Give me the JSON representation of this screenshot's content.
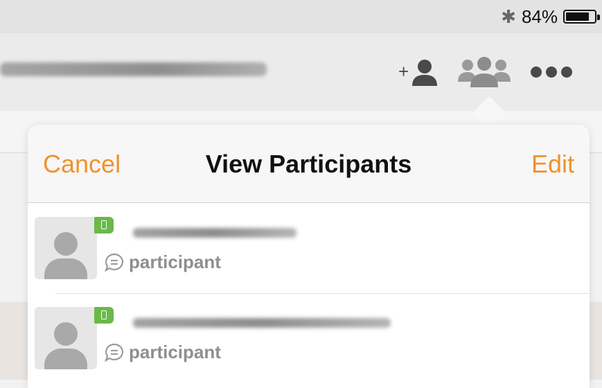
{
  "status_bar": {
    "bluetooth_icon": "bluetooth-icon",
    "battery_percent": "84%",
    "battery_level": 0.84
  },
  "toolbar": {
    "add_participant_icon": "add-person-icon",
    "participants_icon": "group-icon",
    "more_icon": "more-dots-icon"
  },
  "popover": {
    "cancel_label": "Cancel",
    "title": "View Participants",
    "edit_label": "Edit",
    "participants": [
      {
        "role": "participant",
        "device_icon": "mobile-device-icon",
        "chat_icon": "chat-bubble-icon"
      },
      {
        "role": "participant",
        "device_icon": "mobile-device-icon",
        "chat_icon": "chat-bubble-icon"
      }
    ]
  },
  "colors": {
    "accent": "#f0922c",
    "flag_green": "#6bb84b",
    "icon_gray": "#4a4a4a"
  }
}
